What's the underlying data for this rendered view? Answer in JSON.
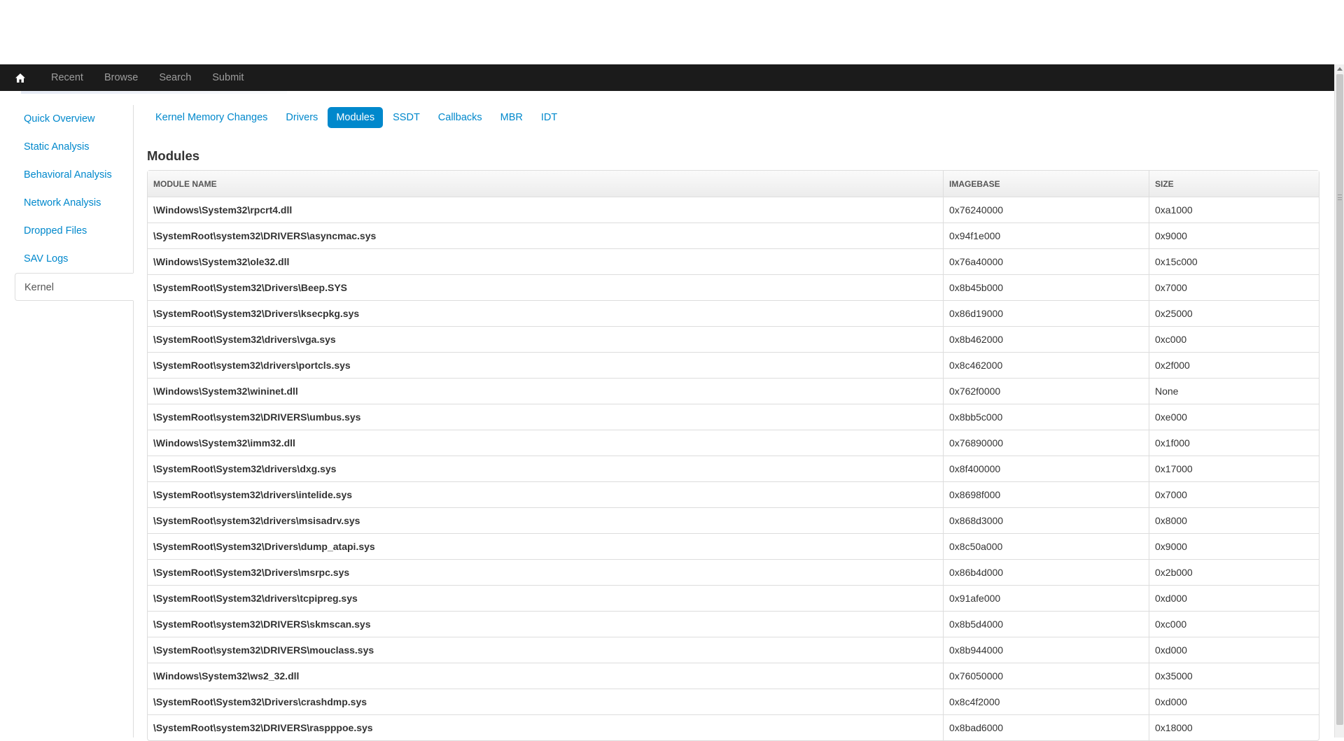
{
  "navbar": {
    "home_icon": "home-icon",
    "links": [
      "Recent",
      "Browse",
      "Search",
      "Submit"
    ]
  },
  "sidebar": {
    "items": [
      {
        "label": "Quick Overview",
        "active": false
      },
      {
        "label": "Static Analysis",
        "active": false
      },
      {
        "label": "Behavioral Analysis",
        "active": false
      },
      {
        "label": "Network Analysis",
        "active": false
      },
      {
        "label": "Dropped Files",
        "active": false
      },
      {
        "label": "SAV Logs",
        "active": false
      },
      {
        "label": "Kernel",
        "active": true
      }
    ]
  },
  "tabs": {
    "items": [
      {
        "label": "Kernel Memory Changes",
        "active": false
      },
      {
        "label": "Drivers",
        "active": false
      },
      {
        "label": "Modules",
        "active": true
      },
      {
        "label": "SSDT",
        "active": false
      },
      {
        "label": "Callbacks",
        "active": false
      },
      {
        "label": "MBR",
        "active": false
      },
      {
        "label": "IDT",
        "active": false
      }
    ]
  },
  "section": {
    "title": "Modules"
  },
  "table": {
    "headers": [
      "MODULE NAME",
      "IMAGEBASE",
      "SIZE"
    ],
    "rows": [
      [
        "\\Windows\\System32\\rpcrt4.dll",
        "0x76240000",
        "0xa1000"
      ],
      [
        "\\SystemRoot\\system32\\DRIVERS\\asyncmac.sys",
        "0x94f1e000",
        "0x9000"
      ],
      [
        "\\Windows\\System32\\ole32.dll",
        "0x76a40000",
        "0x15c000"
      ],
      [
        "\\SystemRoot\\System32\\Drivers\\Beep.SYS",
        "0x8b45b000",
        "0x7000"
      ],
      [
        "\\SystemRoot\\System32\\Drivers\\ksecpkg.sys",
        "0x86d19000",
        "0x25000"
      ],
      [
        "\\SystemRoot\\System32\\drivers\\vga.sys",
        "0x8b462000",
        "0xc000"
      ],
      [
        "\\SystemRoot\\system32\\drivers\\portcls.sys",
        "0x8c462000",
        "0x2f000"
      ],
      [
        "\\Windows\\System32\\wininet.dll",
        "0x762f0000",
        "None"
      ],
      [
        "\\SystemRoot\\system32\\DRIVERS\\umbus.sys",
        "0x8bb5c000",
        "0xe000"
      ],
      [
        "\\Windows\\System32\\imm32.dll",
        "0x76890000",
        "0x1f000"
      ],
      [
        "\\SystemRoot\\System32\\drivers\\dxg.sys",
        "0x8f400000",
        "0x17000"
      ],
      [
        "\\SystemRoot\\system32\\drivers\\intelide.sys",
        "0x8698f000",
        "0x7000"
      ],
      [
        "\\SystemRoot\\system32\\drivers\\msisadrv.sys",
        "0x868d3000",
        "0x8000"
      ],
      [
        "\\SystemRoot\\System32\\Drivers\\dump_atapi.sys",
        "0x8c50a000",
        "0x9000"
      ],
      [
        "\\SystemRoot\\System32\\Drivers\\msrpc.sys",
        "0x86b4d000",
        "0x2b000"
      ],
      [
        "\\SystemRoot\\System32\\drivers\\tcpipreg.sys",
        "0x91afe000",
        "0xd000"
      ],
      [
        "\\SystemRoot\\system32\\DRIVERS\\skmscan.sys",
        "0x8b5d4000",
        "0xc000"
      ],
      [
        "\\SystemRoot\\system32\\DRIVERS\\mouclass.sys",
        "0x8b944000",
        "0xd000"
      ],
      [
        "\\Windows\\System32\\ws2_32.dll",
        "0x76050000",
        "0x35000"
      ],
      [
        "\\SystemRoot\\System32\\Drivers\\crashdmp.sys",
        "0x8c4f2000",
        "0xd000"
      ],
      [
        "\\SystemRoot\\system32\\DRIVERS\\raspppoe.sys",
        "0x8bad6000",
        "0x18000"
      ]
    ]
  }
}
